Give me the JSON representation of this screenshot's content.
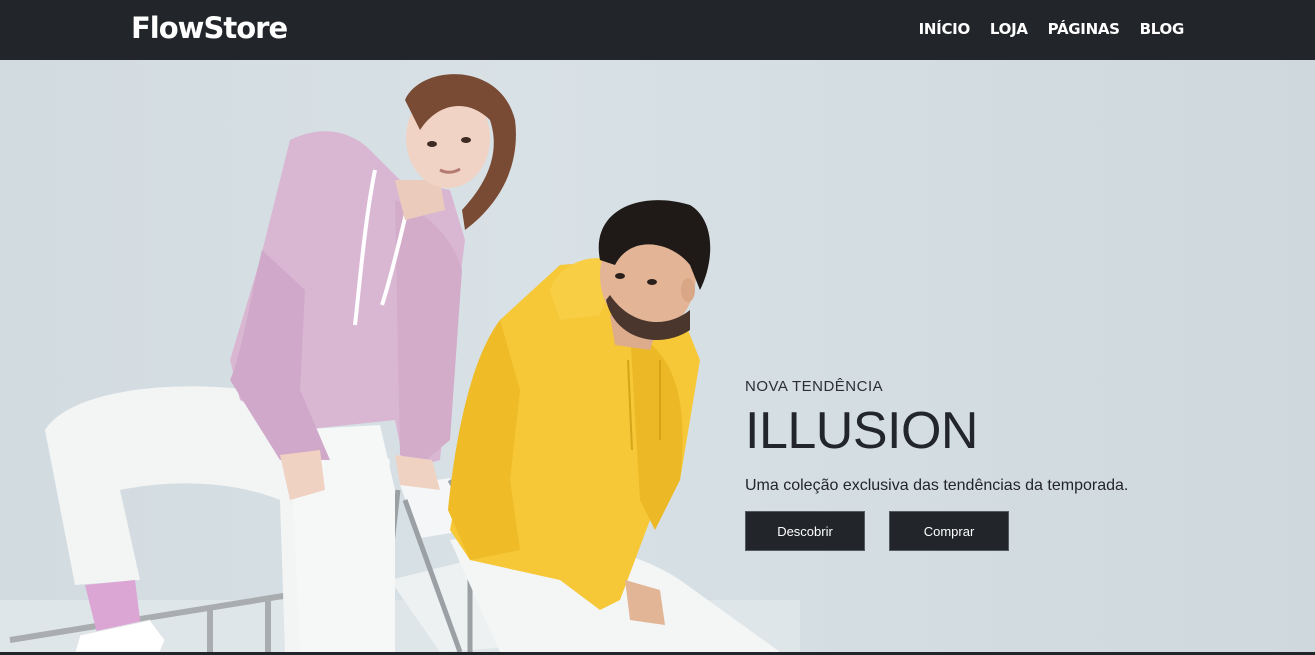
{
  "navbar": {
    "brand": "FlowStore",
    "links": [
      "INÍCIO",
      "LOJA",
      "PÁGINAS",
      "BLOG"
    ]
  },
  "hero": {
    "eyebrow": "NOVA TENDÊNCIA",
    "headline": "ILLUSION",
    "subtitle": "Uma coleção exclusiva das tendências da temporada.",
    "buttons": [
      "Descobrir",
      "Comprar"
    ]
  },
  "colors": {
    "navbar_bg": "#22252a",
    "hero_bg": "#d6dfe3",
    "button_bg": "#22252a",
    "hoodie_pink": "#d9b7d3",
    "hoodie_yellow": "#f6c737"
  }
}
